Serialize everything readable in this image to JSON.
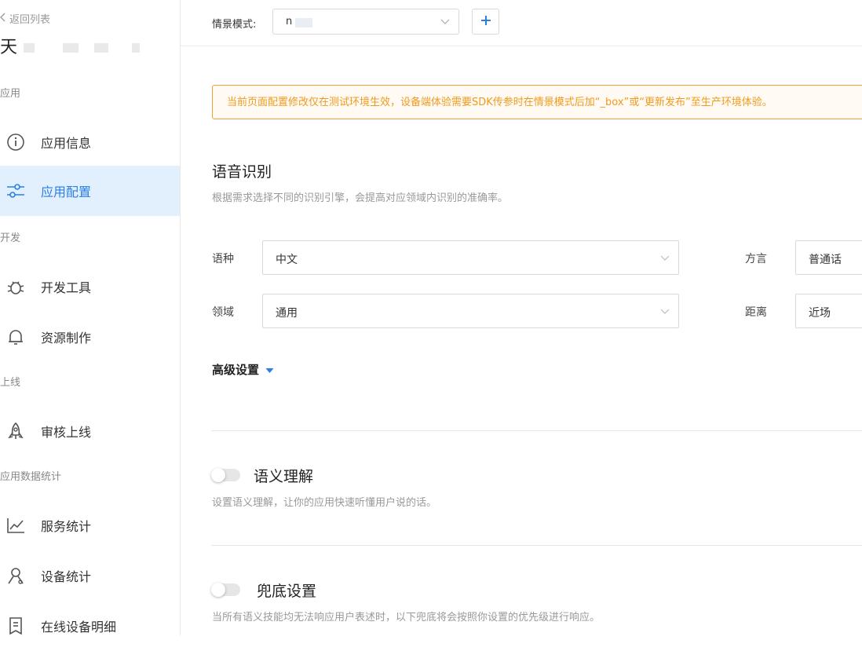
{
  "sidebar": {
    "back_label": "返回列表",
    "app_name": "天",
    "groups": {
      "app": "应用",
      "dev": "开发",
      "online": "上线",
      "stats": "应用数据统计"
    },
    "items": {
      "app_info": "应用信息",
      "app_config": "应用配置",
      "dev_tools": "开发工具",
      "resource": "资源制作",
      "review": "审核上线",
      "service_stats": "服务统计",
      "device_stats": "设备统计",
      "online_devices": "在线设备明细"
    }
  },
  "topbar": {
    "scene_label": "情景模式:",
    "scene_value": "n"
  },
  "notice": "当前页面配置修改仅在测试环境生效，设备端体验需要SDK传参时在情景模式后加“_box”或“更新发布”至生产环境体验。",
  "asr": {
    "title": "语音识别",
    "desc": "根据需求选择不同的识别引擎，会提高对应领域内识别的准确率。",
    "language_label": "语种",
    "language_value": "中文",
    "dialect_label": "方言",
    "dialect_value": "普通话",
    "domain_label": "领域",
    "domain_value": "通用",
    "distance_label": "距离",
    "distance_value": "近场",
    "advanced_label": "高级设置"
  },
  "nlu": {
    "title": "语义理解",
    "desc": "设置语义理解，让你的应用快速听懂用户说的话。",
    "enabled": false
  },
  "fallback": {
    "title": "兜底设置",
    "desc": "当所有语义技能均无法响应用户表述时，以下兜底将会按照你设置的优先级进行响应。",
    "enabled": false
  },
  "colors": {
    "accent": "#2a7ee8",
    "active_bg": "#e2effc",
    "notice_text": "#f09a1c",
    "notice_border": "#f0a23a"
  }
}
